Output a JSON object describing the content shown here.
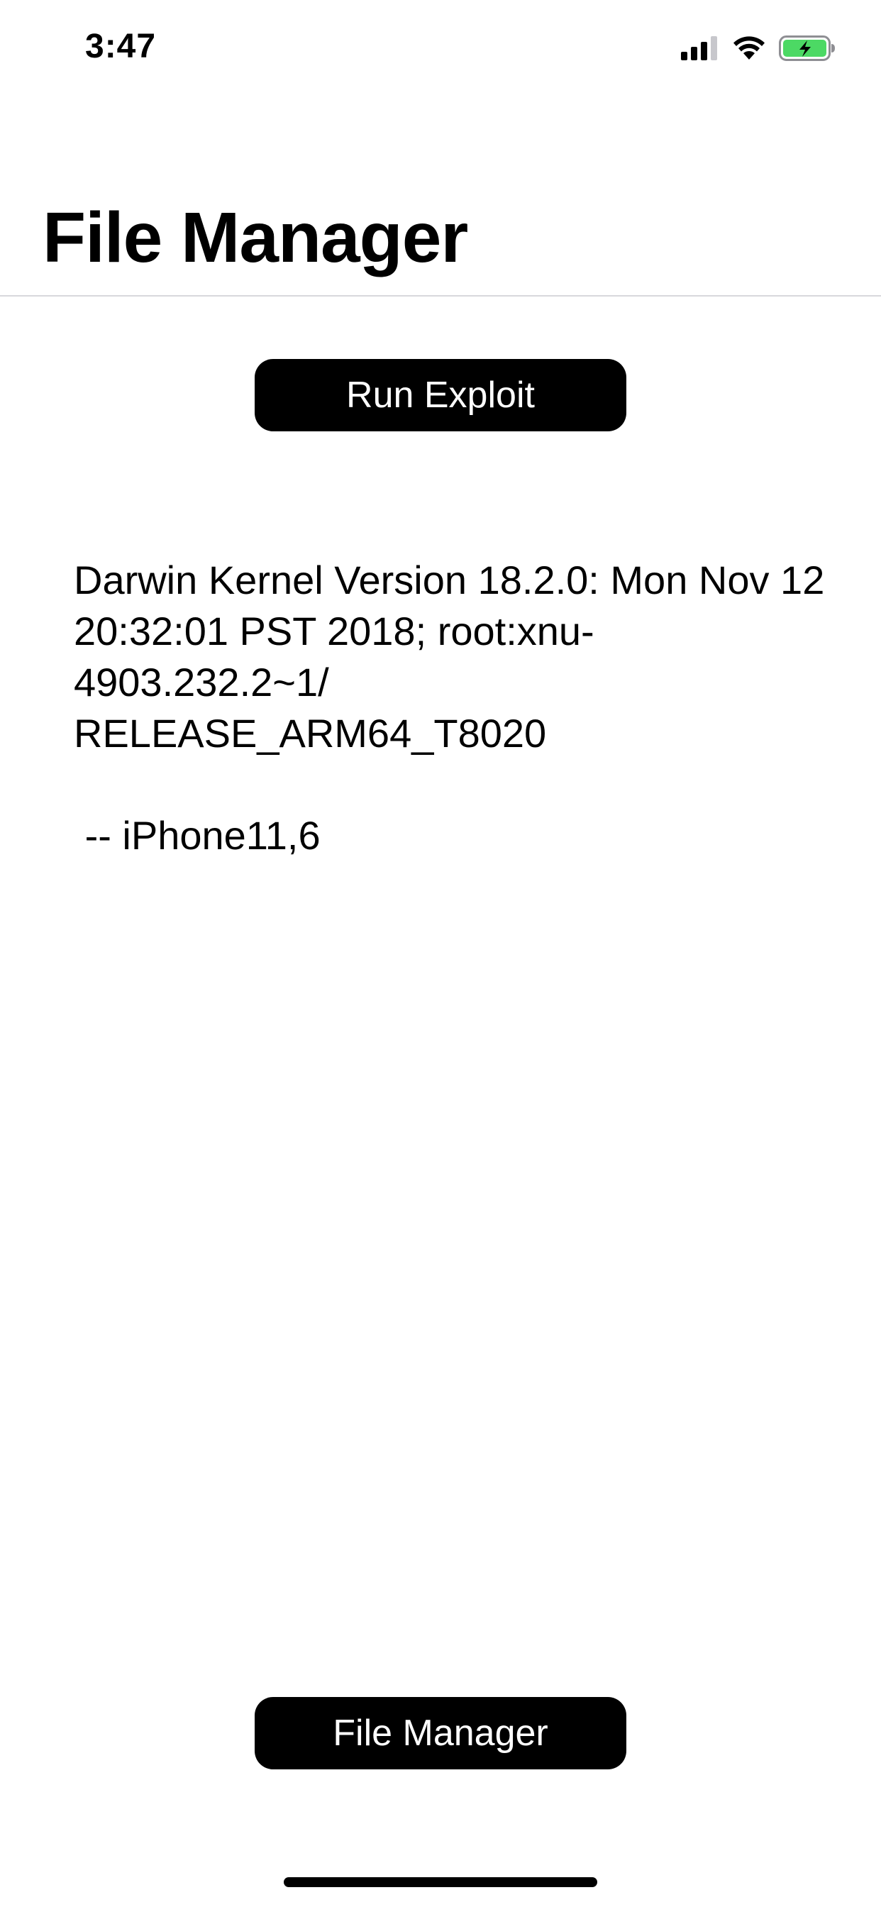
{
  "status_bar": {
    "time": "3:47",
    "icons": [
      "cellular-signal-icon",
      "wifi-icon",
      "battery-charging-icon"
    ],
    "battery_color": "#4cd964"
  },
  "header": {
    "title": "File Manager"
  },
  "main": {
    "run_button_label": "Run Exploit",
    "output": "Darwin Kernel Version 18.2.0: Mon Nov 12 20:32:01 PST 2018; root:xnu-4903.232.2~1/\nRELEASE_ARM64_T8020\n\n -- iPhone11,6"
  },
  "footer": {
    "file_manager_button_label": "File Manager"
  },
  "colors": {
    "button_background": "#000000",
    "button_text": "#ffffff",
    "separator": "#d8d8dc"
  }
}
